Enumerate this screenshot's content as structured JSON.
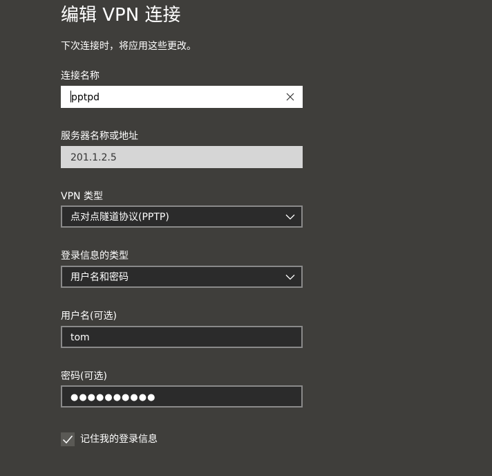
{
  "page": {
    "title": "编辑 VPN 连接",
    "subtitle": "下次连接时，将应用这些更改。"
  },
  "connection_name": {
    "label": "连接名称",
    "value": "pptpd"
  },
  "server": {
    "label": "服务器名称或地址",
    "value": "201.1.2.5"
  },
  "vpn_type": {
    "label": "VPN 类型",
    "selected": "点对点隧道协议(PPTP)"
  },
  "signin_type": {
    "label": "登录信息的类型",
    "selected": "用户名和密码"
  },
  "username": {
    "label": "用户名(可选)",
    "value": "tom"
  },
  "password": {
    "label": "密码(可选)",
    "value": "●●●●●●●●●●"
  },
  "remember": {
    "label": "记住我的登录信息",
    "checked": true
  },
  "icons": {
    "clear": "close-icon",
    "dropdown": "chevron-down-icon",
    "check": "checkmark-icon"
  },
  "colors": {
    "background": "#3f3e3b",
    "field_dark": "#2b2b2b",
    "field_border": "#8a8a8a",
    "field_disabled": "#d6d6d6"
  }
}
